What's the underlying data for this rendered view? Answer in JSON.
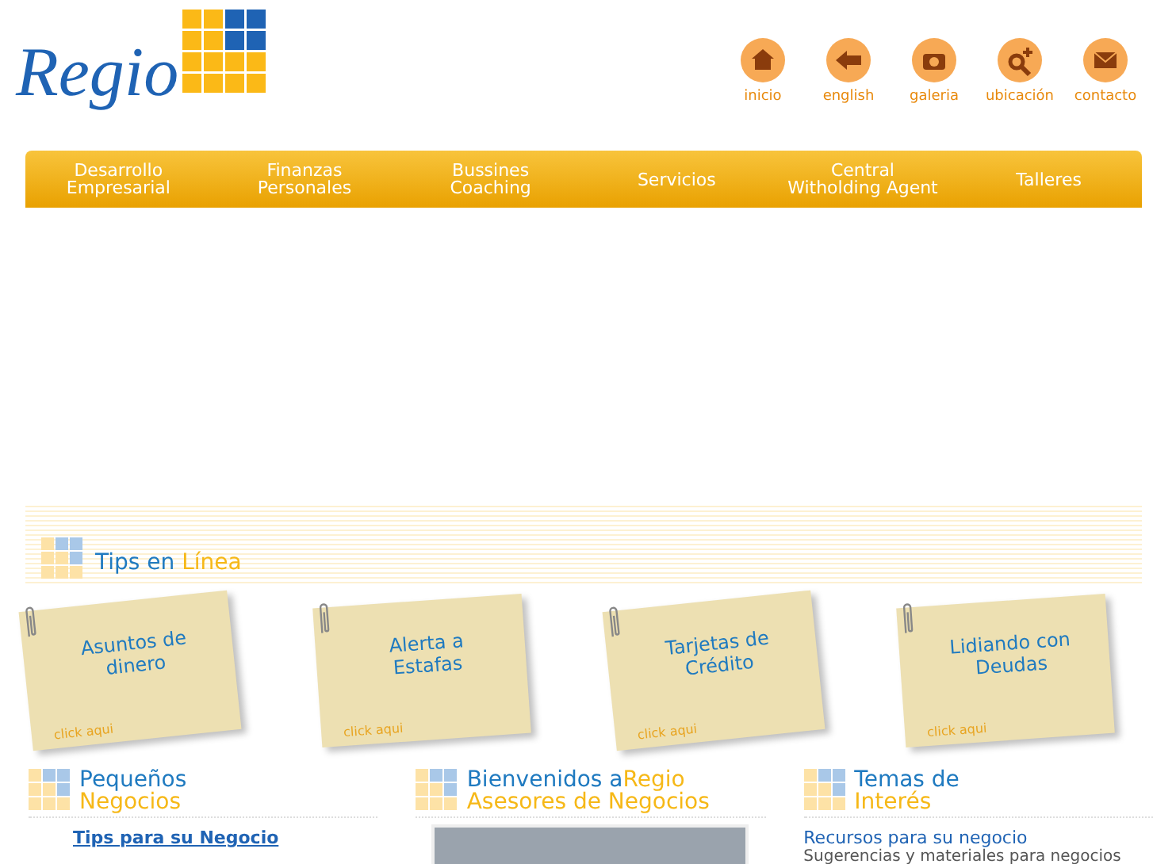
{
  "logo": {
    "text": "Regio"
  },
  "top_links": [
    {
      "label": "inicio",
      "kind": "home"
    },
    {
      "label": "english",
      "kind": "arrow"
    },
    {
      "label": "galeria",
      "kind": "camera"
    },
    {
      "label": "ubicación",
      "kind": "zoom"
    },
    {
      "label": "contacto",
      "kind": "mail"
    }
  ],
  "nav": [
    {
      "label": "Desarrollo Empresarial"
    },
    {
      "label": "Finanzas Personales"
    },
    {
      "label": "Bussines Coaching"
    },
    {
      "label": "Servicios"
    },
    {
      "label": "Central Witholding Agent"
    },
    {
      "label": "Talleres"
    }
  ],
  "tips": {
    "title": "Tips en",
    "title_accent": "Línea",
    "notes": [
      {
        "title": "Asuntos de dinero",
        "link": "click aqui"
      },
      {
        "title": "Alerta a Estafas",
        "link": "click aqui"
      },
      {
        "title": "Tarjetas de Crédito",
        "link": "click aqui"
      },
      {
        "title": "Lidiando con Deudas",
        "link": "click aqui"
      }
    ]
  },
  "columns": [
    {
      "kind": "links",
      "lines": [
        [
          {
            "text": "Pequeños",
            "accent": false
          }
        ],
        [
          {
            "text": "Negocios",
            "accent": true
          }
        ]
      ],
      "links": [
        "Tips para su Negocio"
      ]
    },
    {
      "kind": "photo",
      "lines": [
        [
          {
            "text": "Bienvenidos a",
            "accent": false
          },
          {
            "text": "Regio",
            "accent": true
          }
        ],
        [
          {
            "text": "Asesores de Negocios",
            "accent": true
          }
        ]
      ]
    },
    {
      "kind": "resources",
      "lines": [
        [
          {
            "text": "Temas de",
            "accent": false
          }
        ],
        [
          {
            "text": "Interés",
            "accent": true
          }
        ]
      ],
      "link": "Recursos para su negocio",
      "text": "Sugerencias y materiales para negocios"
    }
  ]
}
